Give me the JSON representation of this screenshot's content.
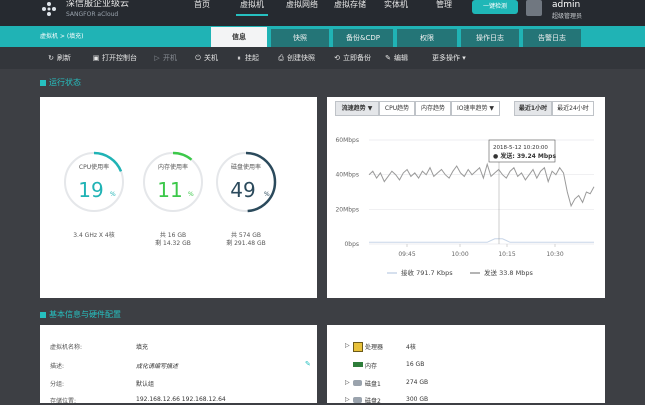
{
  "app": {
    "logo_text": "深信服企业级云",
    "logo_sub": "SANGFOR aCloud",
    "nav": [
      "首页",
      "虚拟机",
      "虚拟网络",
      "虚拟存储",
      "实体机",
      "管理"
    ],
    "active_nav": 1,
    "login_button": "一键检测",
    "user_name": "admin",
    "user_role": "超级管理员"
  },
  "breadcrumb": "虚拟机 > (填充)",
  "tabs": [
    "信息",
    "快照",
    "备份&CDP",
    "权限",
    "操作日志",
    "告警日志"
  ],
  "active_tab": 0,
  "toolbar": [
    {
      "icon": "power-icon",
      "glyph": "↻",
      "label": "刷新",
      "enabled": true
    },
    {
      "icon": "console-icon",
      "glyph": "▣",
      "label": "打开控制台",
      "enabled": true
    },
    {
      "icon": "play-icon",
      "glyph": "▷",
      "label": "开机",
      "enabled": false
    },
    {
      "icon": "shutdown-icon",
      "glyph": "⏻",
      "label": "关机",
      "enabled": true
    },
    {
      "icon": "suspend-icon",
      "glyph": "⏸",
      "label": "挂起",
      "enabled": true
    },
    {
      "icon": "snapshot-icon",
      "glyph": "⎙",
      "label": "创建快照",
      "enabled": true
    },
    {
      "icon": "backup-icon",
      "glyph": "⟲",
      "label": "立即备份",
      "enabled": true
    },
    {
      "icon": "edit-icon",
      "glyph": "✎",
      "label": "编辑",
      "enabled": true
    },
    {
      "icon": "more-icon",
      "glyph": "",
      "label": "更多操作 ▾",
      "enabled": true
    }
  ],
  "status_section": {
    "title": "运行状态",
    "gauges": [
      {
        "label": "CPU使用率",
        "value": "19",
        "unit": "%",
        "fraction": 0.19,
        "sub1": "3.4 GHz X 4核",
        "sub2": ""
      },
      {
        "label": "内存使用率",
        "value": "11",
        "unit": "%",
        "fraction": 0.11,
        "sub1": "共 16 GB",
        "sub2": "剩 14.32 GB"
      },
      {
        "label": "磁盘使用率",
        "value": "49",
        "unit": "%",
        "fraction": 0.49,
        "sub1": "共 574 GB",
        "sub2": "剩 291.48 GB"
      }
    ]
  },
  "chart_controls": {
    "left": [
      "流速趋势 ▼",
      "CPU趋势",
      "内存趋势",
      "IO速率趋势 ▼"
    ],
    "left_selected": 0,
    "right": [
      "最近1小时",
      "最近24小时"
    ],
    "right_selected": 0
  },
  "chart_data": {
    "type": "line",
    "x_ticks": [
      "09:45",
      "10:00",
      "10:15",
      "10:30"
    ],
    "y_ticks": [
      "60Mbps",
      "40Mbps",
      "20Mbps",
      "0bps"
    ],
    "ylim": [
      0,
      60
    ],
    "ylabel": "",
    "series": [
      {
        "name": "接收 791.7 Kbps",
        "color": "#c8d6e8",
        "values": [
          1,
          1,
          1,
          1,
          1,
          1,
          1,
          1,
          1,
          1,
          1,
          1,
          1,
          1,
          1,
          1,
          1,
          1,
          1,
          1,
          1,
          1,
          1,
          1,
          1,
          1,
          1,
          1,
          1,
          1,
          1,
          1,
          2,
          3,
          3,
          3,
          2,
          1,
          1,
          1,
          1,
          1,
          1,
          1,
          1,
          1,
          1,
          1,
          1,
          1,
          1,
          1,
          1,
          1,
          1,
          1,
          1,
          1,
          1,
          1
        ]
      },
      {
        "name": "发送 33.8 Mbps",
        "color": "#9a9a9a",
        "values": [
          40,
          42,
          38,
          41,
          36,
          39,
          42,
          40,
          37,
          41,
          43,
          39,
          41,
          38,
          42,
          40,
          44,
          39,
          41,
          43,
          40,
          38,
          42,
          45,
          41,
          39,
          43,
          40,
          42,
          44,
          38,
          46,
          39,
          41,
          43,
          40,
          38,
          42,
          44,
          39,
          41,
          37,
          40,
          43,
          38,
          42,
          44,
          36,
          42,
          40,
          44,
          41,
          30,
          22,
          26,
          28,
          24,
          30,
          29,
          33
        ]
      }
    ],
    "tooltip": {
      "date": "2018-5-12 10:20:00",
      "text": "● 发送: 39.24 Mbps"
    }
  },
  "info_section": {
    "title": "基本信息与硬件配置",
    "rows": [
      {
        "k": "虚拟机名称:",
        "v": "填充"
      },
      {
        "k": "描述:",
        "v": "成化请编写描述"
      },
      {
        "k": "分组:",
        "v": "默认组"
      },
      {
        "k": "存储位置:",
        "v": "192.168.12.66 192.168.12.64"
      }
    ],
    "hardware": [
      {
        "icon": "cpu-icon",
        "name": "处理器",
        "v": "4核"
      },
      {
        "icon": "memory-icon",
        "name": "内存",
        "v": "16 GB"
      },
      {
        "icon": "disk-icon",
        "name": "磁盘1",
        "v": "274 GB"
      },
      {
        "icon": "disk-icon",
        "name": "磁盘2",
        "v": "300 GB"
      }
    ]
  }
}
